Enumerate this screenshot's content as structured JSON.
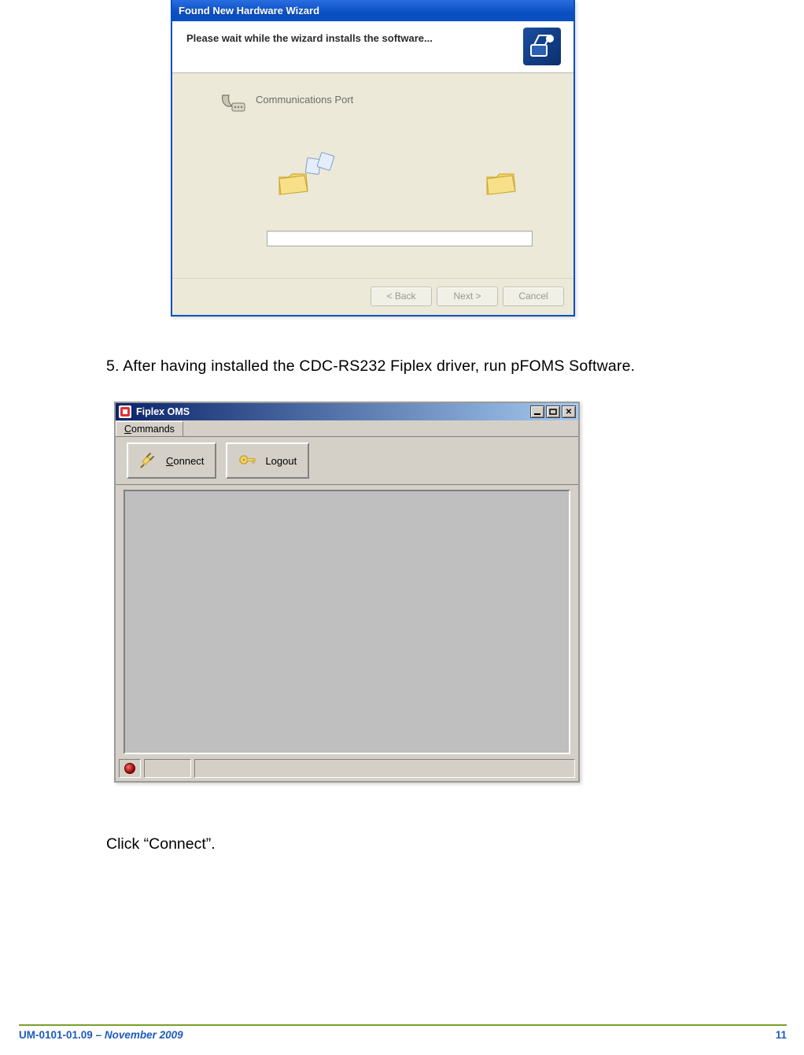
{
  "wizard": {
    "title": "Found New Hardware Wizard",
    "heading": "Please wait while the wizard installs the software...",
    "device": "Communications Port",
    "buttons": {
      "back": "< Back",
      "next": "Next >",
      "cancel": "Cancel"
    }
  },
  "body": {
    "step": "5. After having installed the CDC-RS232 Fiplex driver, run pFOMS Software.",
    "click": "Click “Connect”."
  },
  "oms": {
    "title": "Fiplex OMS",
    "menu": {
      "commands": "Commands"
    },
    "toolbar": {
      "connect": "Connect",
      "logout": "Logout"
    }
  },
  "footer": {
    "doc_id": "UM-0101-01.09",
    "sep": " – ",
    "month": "November 2009",
    "page": "11"
  }
}
